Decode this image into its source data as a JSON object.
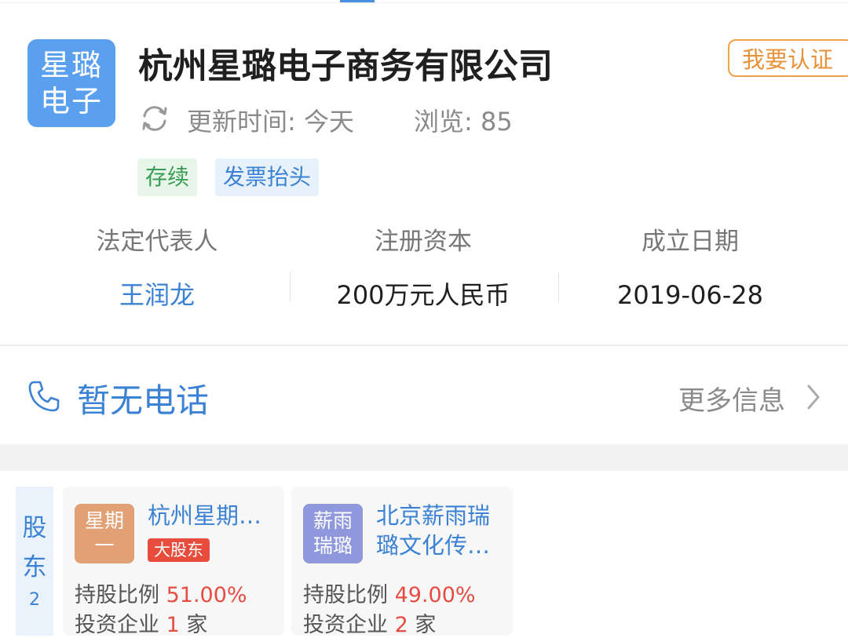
{
  "company": {
    "logo_line1": "星璐",
    "logo_line2": "电子",
    "name": "杭州星璐电子商务有限公司",
    "certify_label": "我要认证",
    "update_text": "更新时间: 今天",
    "views_text": "浏览: 85",
    "tags": [
      {
        "label": "存续"
      },
      {
        "label": "发票抬头"
      }
    ]
  },
  "info": [
    {
      "label": "法定代表人",
      "value": "王润龙"
    },
    {
      "label": "注册资本",
      "value": "200万元人民币"
    },
    {
      "label": "成立日期",
      "value": "2019-06-28"
    }
  ],
  "contact": {
    "phone_text": "暂无电话",
    "more_label": "更多信息"
  },
  "shareholders": {
    "tab_label_1": "股",
    "tab_label_2": "东",
    "count": "2",
    "items": [
      {
        "logo_line1": "星期",
        "logo_line2": "一",
        "name": "杭州星期…",
        "badge": "大股东",
        "ratio_label": "持股比例",
        "ratio_value": "51.00%",
        "invest_prefix": "投资企业",
        "invest_count": "1",
        "invest_suffix": "家"
      },
      {
        "logo_line1": "薪雨",
        "logo_line2": "瑞璐",
        "name": "北京薪雨瑞璐文化传…",
        "ratio_label": "持股比例",
        "ratio_value": "49.00%",
        "invest_prefix": "投资企业",
        "invest_count": "2",
        "invest_suffix": "家"
      }
    ]
  },
  "colors": {
    "accent": "#3b82d4",
    "logo_bg": "#5aa0ee",
    "certify": "#e8923a",
    "status_green": "#3b9c55",
    "badge_red": "#e74c3c"
  },
  "icons": [
    "refresh-icon",
    "phone-icon",
    "chevron-right-icon"
  ]
}
